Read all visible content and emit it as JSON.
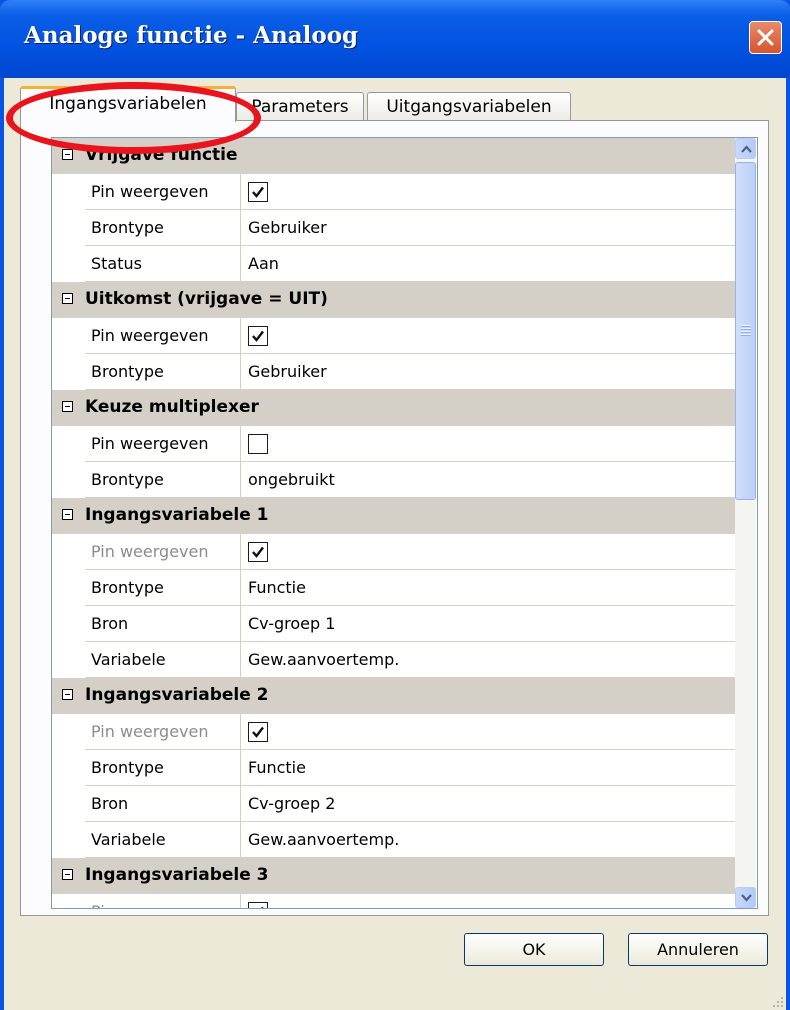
{
  "window": {
    "title": "Analoge functie - Analoog"
  },
  "tabs": [
    {
      "label": "Ingangsvariabelen",
      "active": true
    },
    {
      "label": "Parameters",
      "active": false
    },
    {
      "label": "Uitgangsvariabelen",
      "active": false
    }
  ],
  "grid": {
    "categories": [
      {
        "label": "Vrijgave functie",
        "rows": [
          {
            "name": "Pin weergeven",
            "type": "checkbox",
            "checked": true,
            "disabled": false
          },
          {
            "name": "Brontype",
            "value": "Gebruiker"
          },
          {
            "name": "Status",
            "value": "Aan"
          }
        ]
      },
      {
        "label": "Uitkomst (vrijgave = UIT)",
        "rows": [
          {
            "name": "Pin weergeven",
            "type": "checkbox",
            "checked": true,
            "disabled": false
          },
          {
            "name": "Brontype",
            "value": "Gebruiker"
          }
        ]
      },
      {
        "label": "Keuze multiplexer",
        "rows": [
          {
            "name": "Pin weergeven",
            "type": "checkbox",
            "checked": false,
            "disabled": false
          },
          {
            "name": "Brontype",
            "value": "ongebruikt"
          }
        ]
      },
      {
        "label": "Ingangsvariabele 1",
        "rows": [
          {
            "name": "Pin weergeven",
            "type": "checkbox",
            "checked": true,
            "disabled": true
          },
          {
            "name": "Brontype",
            "value": "Functie"
          },
          {
            "name": "Bron",
            "value": "Cv-groep 1"
          },
          {
            "name": "Variabele",
            "value": "Gew.aanvoertemp."
          }
        ]
      },
      {
        "label": "Ingangsvariabele 2",
        "rows": [
          {
            "name": "Pin weergeven",
            "type": "checkbox",
            "checked": true,
            "disabled": true
          },
          {
            "name": "Brontype",
            "value": "Functie"
          },
          {
            "name": "Bron",
            "value": "Cv-groep 2"
          },
          {
            "name": "Variabele",
            "value": "Gew.aanvoertemp."
          }
        ]
      },
      {
        "label": "Ingangsvariabele 3",
        "rows": [
          {
            "name": "Pin weergeven",
            "type": "checkbox",
            "checked": true,
            "disabled": true
          }
        ]
      }
    ]
  },
  "buttons": {
    "ok": "OK",
    "cancel": "Annuleren"
  },
  "colors": {
    "title_bar": "#0052e0",
    "dialog_bg": "#ece9d8",
    "category_bg": "#d4d0c8",
    "highlight": "#e8141e",
    "active_tab_accent": "#f7b032"
  },
  "icons": {
    "close": "close-icon",
    "collapse": "collapse-icon",
    "scroll_up": "chevron-up-icon",
    "scroll_down": "chevron-down-icon",
    "check": "checkmark-icon",
    "size_grip": "size-grip-icon"
  }
}
